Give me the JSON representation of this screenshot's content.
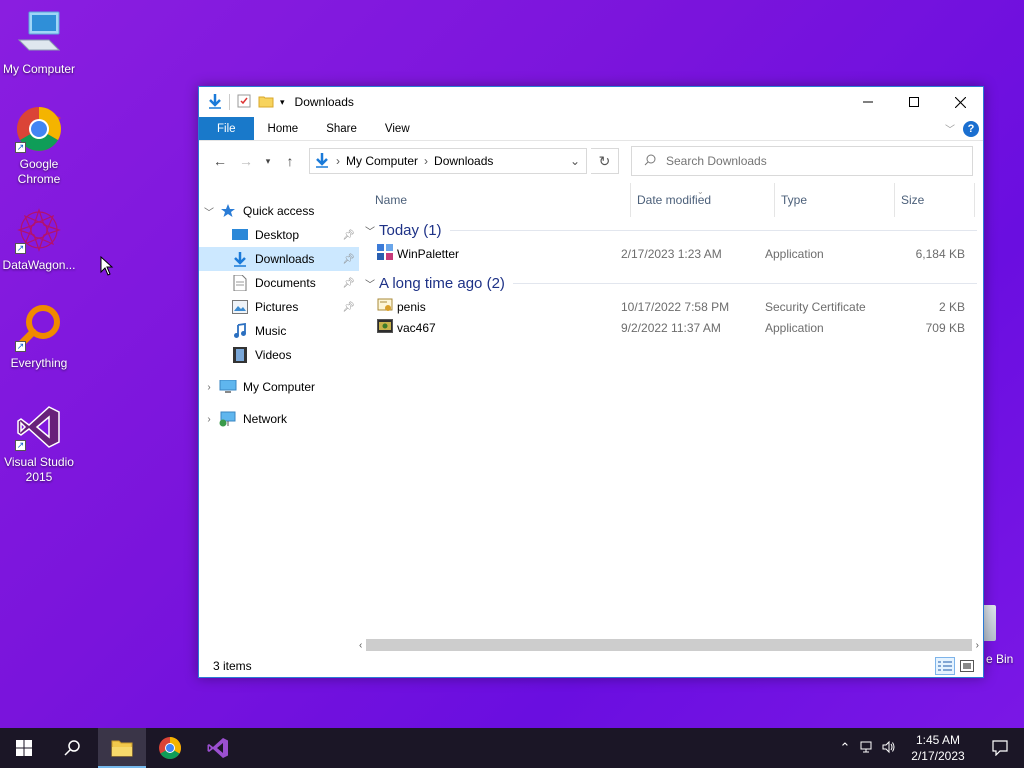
{
  "desktop": {
    "icons": [
      {
        "label": "My Computer",
        "icon": "computer-icon"
      },
      {
        "label": "Google Chrome",
        "icon": "chrome-icon"
      },
      {
        "label": "DataWagon...",
        "icon": "datawagon-icon"
      },
      {
        "label": "Everything",
        "icon": "everything-search-icon"
      },
      {
        "label": "Visual Studio 2015",
        "icon": "visual-studio-icon"
      }
    ],
    "recycle_bin_label": "e Bin"
  },
  "window": {
    "title": "Downloads",
    "ribbon_tabs": [
      "File",
      "Home",
      "Share",
      "View"
    ],
    "help_label": "?",
    "address": {
      "parts": [
        "My Computer",
        "Downloads"
      ]
    },
    "search": {
      "placeholder": "Search Downloads"
    },
    "nav": {
      "quick_access": "Quick access",
      "items": [
        {
          "label": "Desktop",
          "icon": "desktop-folder-icon",
          "pinned": true
        },
        {
          "label": "Downloads",
          "icon": "downloads-folder-icon",
          "pinned": true,
          "selected": true
        },
        {
          "label": "Documents",
          "icon": "documents-folder-icon",
          "pinned": true
        },
        {
          "label": "Pictures",
          "icon": "pictures-folder-icon",
          "pinned": true
        },
        {
          "label": "Music",
          "icon": "music-folder-icon",
          "pinned": false
        },
        {
          "label": "Videos",
          "icon": "videos-folder-icon",
          "pinned": false
        }
      ],
      "my_computer": "My Computer",
      "network": "Network"
    },
    "columns": [
      "Name",
      "Date modified",
      "Type",
      "Size"
    ],
    "groups": [
      {
        "label": "Today (1)",
        "files": [
          {
            "name": "WinPaletter",
            "date": "2/17/2023 1:23 AM",
            "type": "Application",
            "size": "6,184 KB",
            "icon": "winpaletter-app-icon"
          }
        ]
      },
      {
        "label": "A long time ago (2)",
        "files": [
          {
            "name": "penis",
            "date": "10/17/2022 7:58 PM",
            "type": "Security Certificate",
            "size": "2 KB",
            "icon": "certificate-file-icon"
          },
          {
            "name": "vac467",
            "date": "9/2/2022 11:37 AM",
            "type": "Application",
            "size": "709 KB",
            "icon": "application-file-icon"
          }
        ]
      }
    ],
    "status": "3 items"
  },
  "taskbar": {
    "time": "1:45 AM",
    "date": "2/17/2023"
  }
}
